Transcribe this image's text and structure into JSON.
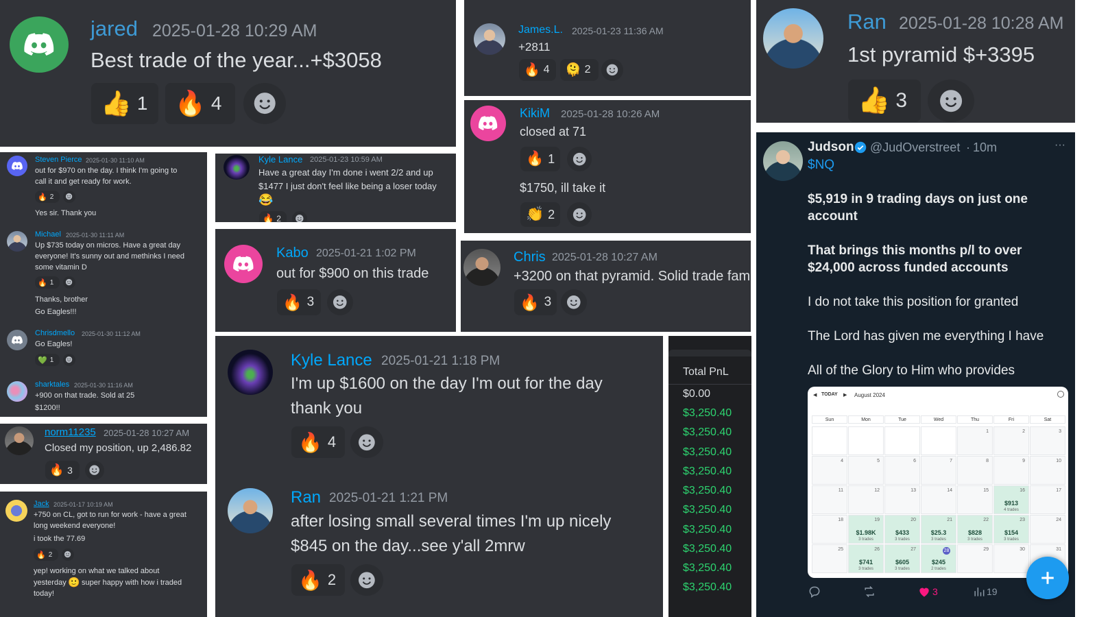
{
  "p1": {
    "name": "jared",
    "ts": "2025-01-28 10:29 AM",
    "msg": "Best trade of the year...+$3058",
    "r1": "👍",
    "c1": "1",
    "r2": "🔥",
    "c2": "4"
  },
  "p2": {
    "name": "James.L.",
    "ts": "2025-01-23 11:36 AM",
    "msg": "+2811",
    "r1": "🔥",
    "c1": "4",
    "r2": "🫠",
    "c2": "2"
  },
  "p3": {
    "name": "Ran",
    "ts": "2025-01-28 10:28 AM",
    "msg": "1st pyramid $+3395",
    "r1": "👍",
    "c1": "3"
  },
  "p4": {
    "entries": [
      {
        "name": "Steven Pierce",
        "ts": "2025-01-30 11:10 AM",
        "msg1": "out for $970 on the day.  I think I'm going to",
        "msg2": "call it and get ready for work.",
        "r": "🔥",
        "c": "2",
        "reply": "Yes sir.  Thank you"
      },
      {
        "name": "Michael",
        "ts": "2025-01-30 11:11 AM",
        "msg1": "Up $735 today on micros. Have a great day",
        "msg2": "everyone! It's sunny out and methinks I need",
        "msg3": "some vitamin D",
        "r": "🔥",
        "c": "1",
        "reply1": "Thanks, brother",
        "reply2": "Go Eagles!!!"
      },
      {
        "name": "Chrisdmello",
        "ts": "2025-01-30 11:12 AM",
        "msg1": "Go Eagles!",
        "r": "💚",
        "c": "1"
      },
      {
        "name": "sharktales",
        "ts": "2025-01-30 11:16 AM",
        "msg1": "+900 on that trade. Sold at 25",
        "msg2": "$1200!!"
      }
    ]
  },
  "p5": {
    "name": "Kyle Lance",
    "ts": "2025-01-23 10:59 AM",
    "msg1": "Have a great day I'm done i went 2/2 and up",
    "msg2": "$1477 I just don't feel like being a loser today",
    "emoji": "😂",
    "r": "🔥",
    "c": "2"
  },
  "p6": {
    "name": "KikiM",
    "ts": "2025-01-28 10:26 AM",
    "msg1": "closed at 71",
    "r1": "🔥",
    "c1": "1",
    "msg2": "$1750, ill take it",
    "r2": "👏",
    "c2": "2"
  },
  "p7": {
    "name": "Kabo",
    "ts": "2025-01-21 1:02 PM",
    "msg": "out for $900 on this trade",
    "r": "🔥",
    "c": "3"
  },
  "p8": {
    "name": "Chris",
    "ts": "2025-01-28 10:27 AM",
    "msg": "+3200 on that pyramid. Solid trade fam",
    "r": "🔥",
    "c": "3"
  },
  "p9": {
    "name": "norm11235",
    "ts": "2025-01-28 10:27 AM",
    "msg": "Closed my position, up 2,486.82",
    "r": "🔥",
    "c": "3"
  },
  "p10": {
    "name": "Kyle Lance",
    "ts": "2025-01-21 1:18 PM",
    "msg1": "I'm up $1600 on the day I'm out for the day",
    "msg2": "thank you",
    "r": "🔥",
    "c": "4"
  },
  "p11": {
    "name": "Ran",
    "ts": "2025-01-21 1:21 PM",
    "msg1": "after losing small several times I'm up nicely",
    "msg2": "$845 on the day...see y'all 2mrw",
    "r": "🔥",
    "c": "2"
  },
  "p12": {
    "name": "Jack",
    "ts": "2025-01-17 10:19 AM",
    "msg1": "+750 on CL, got to run for work - have a great",
    "msg2": "long weekend everyone!",
    "msg3": "i took the 77.69",
    "r": "🔥",
    "c": "2",
    "reply1": "yep! working on what we talked about",
    "reply2a": "yesterday",
    "reply2emoji": "🙂",
    "reply2b": "super happy with how i traded",
    "reply3": "today!"
  },
  "pnl": {
    "header": "Total PnL",
    "first": "$0.00",
    "rows": [
      "$3,250.40",
      "$3,250.40",
      "$3,250.40",
      "$3,250.40",
      "$3,250.40",
      "$3,250.40",
      "$3,250.40",
      "$3,250.40",
      "$3,250.40",
      "$3,250.40"
    ]
  },
  "tweet": {
    "name": "Judson",
    "handle": "@JudOverstreet",
    "time": "10m",
    "sep": "·",
    "ticker": "$NQ",
    "bold1": "$5,919 in 9 trading days on just one",
    "bold2": "account",
    "bold3": "That brings this months p/l to over",
    "bold4": "$24,000 across funded accounts",
    "line1": "I do not take this position for granted",
    "line2": "The Lord has given me everything I have",
    "line3": "All of the Glory to Him who provides",
    "more": "···",
    "likes": "3",
    "views": "19",
    "cal": {
      "today": "TODAY",
      "month": "August 2024",
      "dows": [
        "Sun",
        "Mon",
        "Tue",
        "Wed",
        "Thu",
        "Fri",
        "Sat"
      ],
      "weeks": [
        [
          {
            "d": ""
          },
          {
            "d": ""
          },
          {
            "d": ""
          },
          {
            "d": ""
          },
          {
            "d": "1"
          },
          {
            "d": "2"
          },
          {
            "d": "3"
          }
        ],
        [
          {
            "d": "4"
          },
          {
            "d": "5"
          },
          {
            "d": "6"
          },
          {
            "d": "7"
          },
          {
            "d": "8"
          },
          {
            "d": "9"
          },
          {
            "d": "10"
          }
        ],
        [
          {
            "d": "11"
          },
          {
            "d": "12"
          },
          {
            "d": "13"
          },
          {
            "d": "14"
          },
          {
            "d": "15"
          },
          {
            "d": "16",
            "amt": "$913",
            "tr": "4 trades"
          },
          {
            "d": "17"
          }
        ],
        [
          {
            "d": "18"
          },
          {
            "d": "19",
            "amt": "$1.98K",
            "tr": "3 trades"
          },
          {
            "d": "20",
            "amt": "$433",
            "tr": "3 trades"
          },
          {
            "d": "21",
            "amt": "$25.3",
            "tr": "3 trades"
          },
          {
            "d": "22",
            "amt": "$828",
            "tr": "3 trades"
          },
          {
            "d": "23",
            "amt": "$154",
            "tr": "3 trades"
          },
          {
            "d": "24"
          }
        ],
        [
          {
            "d": "25"
          },
          {
            "d": "26",
            "amt": "$741",
            "tr": "3 trades"
          },
          {
            "d": "27",
            "amt": "$605",
            "tr": "3 trades"
          },
          {
            "d": "28",
            "amt": "$245",
            "tr": "2 trades",
            "today": true
          },
          {
            "d": "29"
          },
          {
            "d": "30"
          },
          {
            "d": "31"
          }
        ]
      ]
    }
  },
  "colors": {
    "discord_bg": "#313338",
    "name_blue": "#00a8fc",
    "pnl_green": "#2dd36f",
    "twitter_bg": "#15202b",
    "fab": "#1d9bf0"
  }
}
